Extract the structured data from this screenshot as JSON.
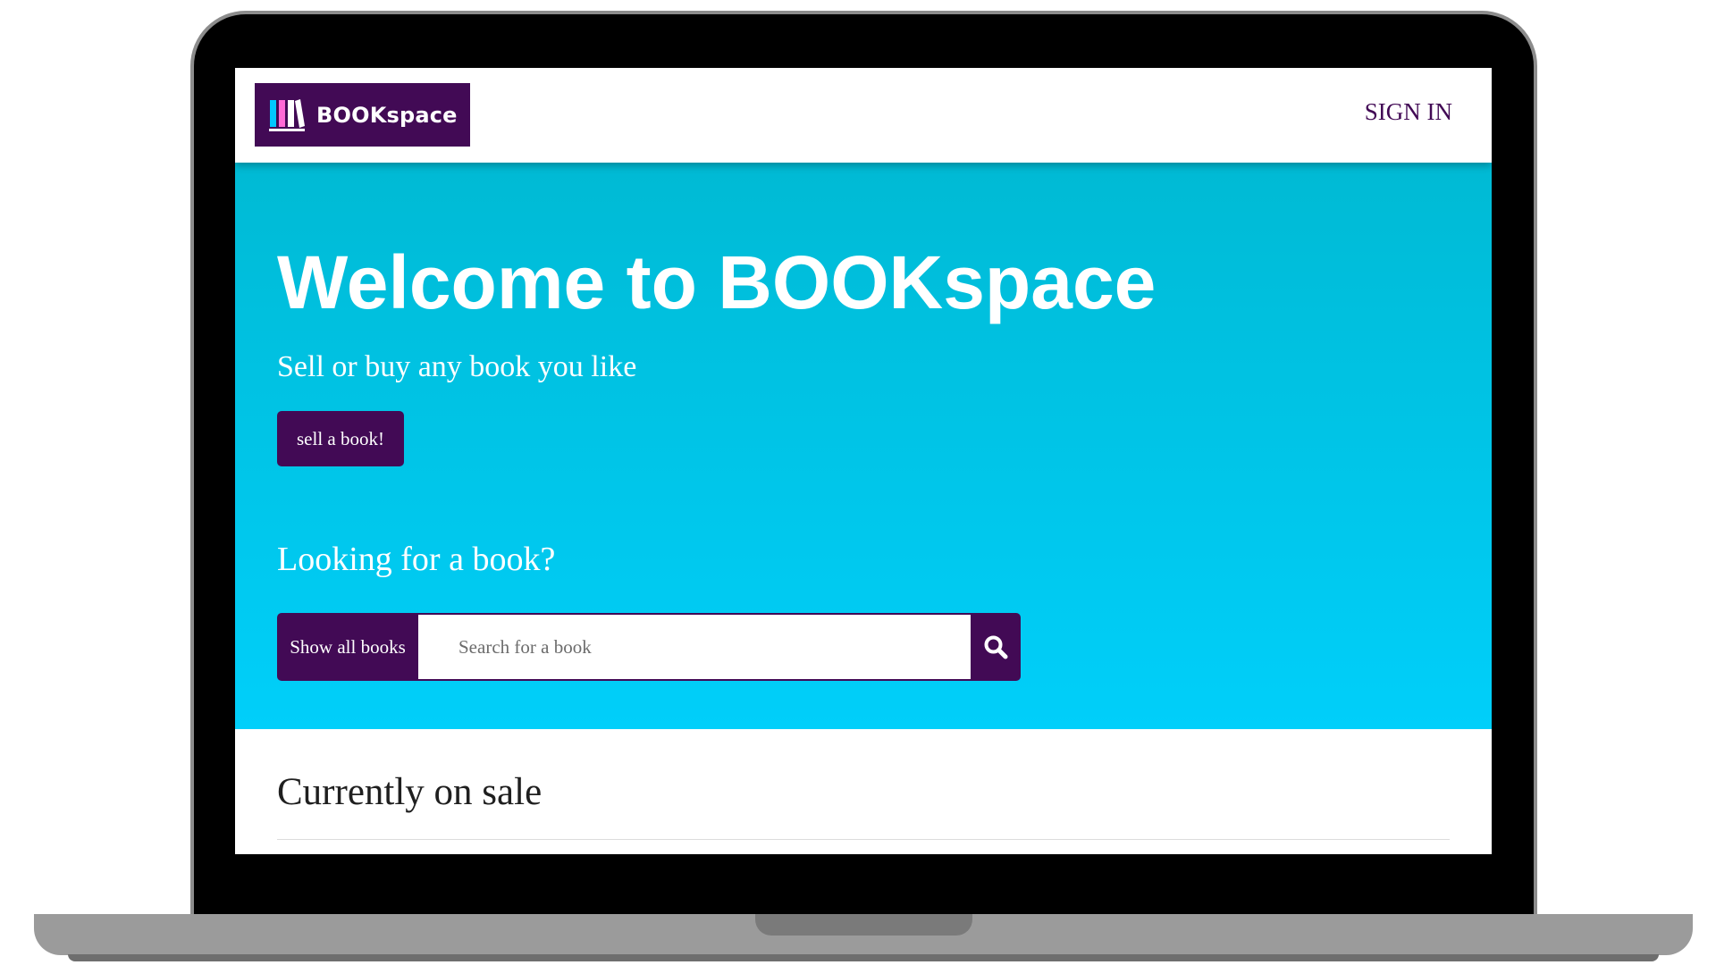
{
  "navbar": {
    "brand_name": "BOOKspace",
    "sign_in_label": "SIGN IN"
  },
  "hero": {
    "title": "Welcome to BOOKspace",
    "subtitle": "Sell or buy any book you like",
    "sell_button_label": "sell a book!",
    "search_heading": "Looking for a book?"
  },
  "search": {
    "show_all_label": "Show all books",
    "placeholder": "Search for a book",
    "value": "",
    "button_icon": "search-icon"
  },
  "content": {
    "section_title": "Currently on sale"
  },
  "colors": {
    "brand_purple": "#420a55",
    "hero_gradient_top": "#00bad4",
    "hero_gradient_bottom": "#00cffa",
    "logo_cyan": "#00c8ff",
    "logo_pink": "#ff6ad5",
    "logo_white": "#ffffff"
  }
}
